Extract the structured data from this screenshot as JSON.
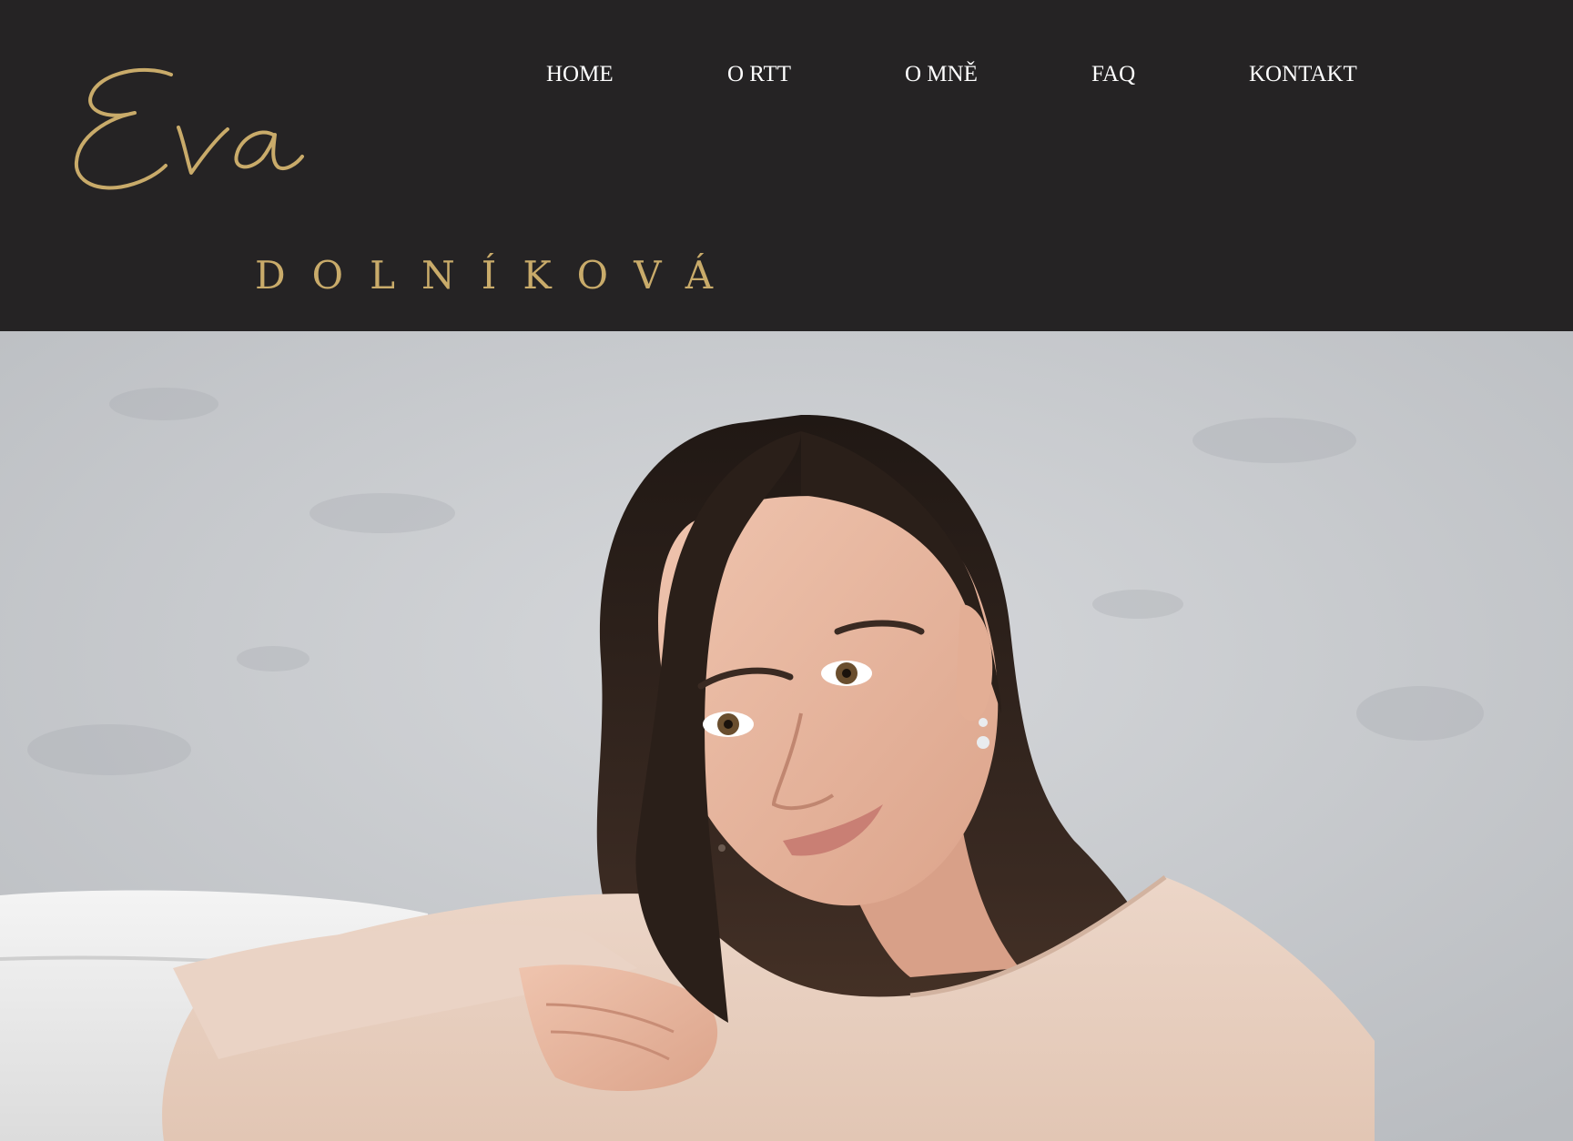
{
  "logo": {
    "script_text": "Eva",
    "sub_text": "DOLNÍKOVÁ",
    "gold_color": "#c9ab6a"
  },
  "nav": {
    "items": [
      {
        "label": "HOME"
      },
      {
        "label": "O RTT"
      },
      {
        "label": "O MNĚ"
      },
      {
        "label": "FAQ"
      },
      {
        "label": "KONTAKT"
      }
    ]
  },
  "hero": {
    "photo_subject": "portrait-photo"
  },
  "colors": {
    "header_bg": "#252324",
    "nav_text": "#ffffff",
    "accent_gold": "#c9ab6a",
    "hero_wall": "#c7c9cc"
  }
}
